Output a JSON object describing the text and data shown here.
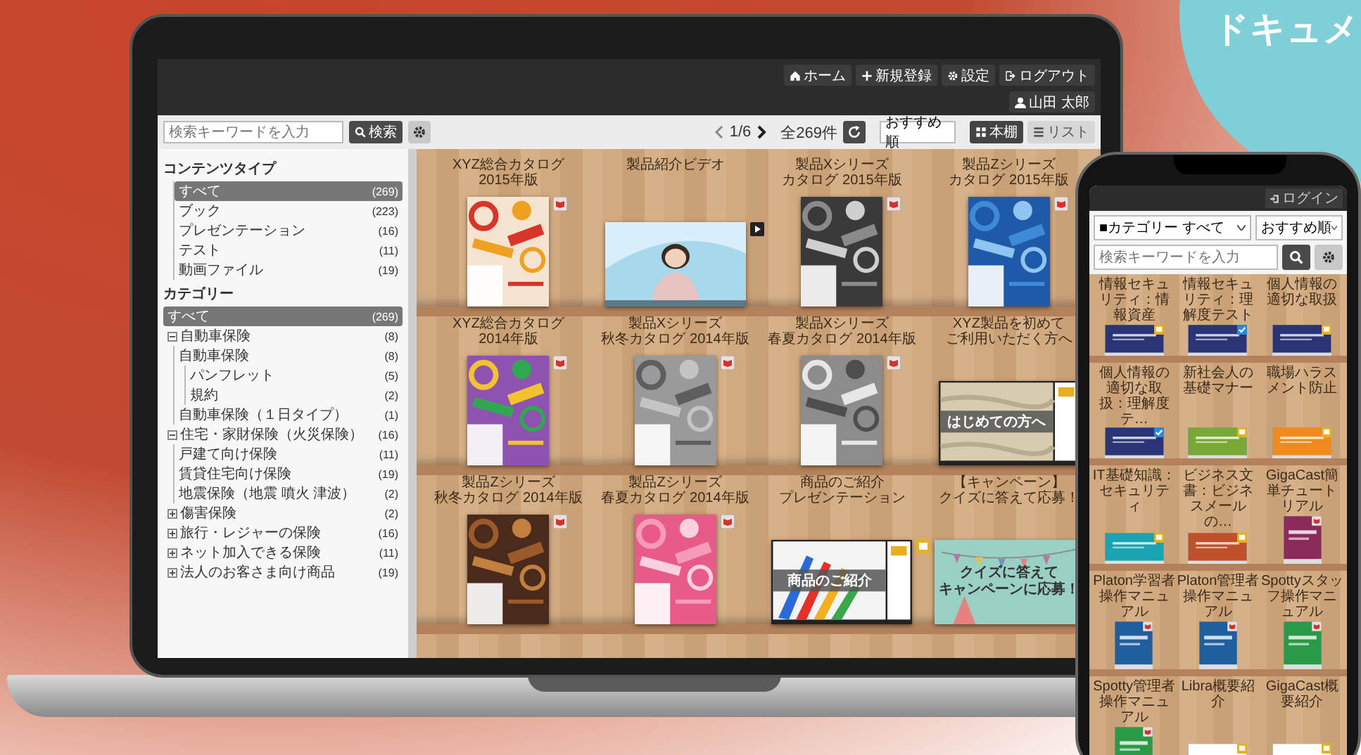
{
  "laptop": {
    "header": {
      "buttons": [
        {
          "kind": "home",
          "label": "ホーム"
        },
        {
          "kind": "add",
          "label": "新規登録"
        },
        {
          "kind": "settings",
          "label": "設定"
        },
        {
          "kind": "logout",
          "label": "ログアウト"
        }
      ],
      "user": "山田 太郎"
    },
    "toolbar": {
      "search": {
        "placeholder": "検索キーワードを入力",
        "button": "検索"
      },
      "page": "1/6",
      "total": "全269件",
      "sort": "おすすめ順",
      "views": [
        {
          "kind": "shelf",
          "label": "本棚",
          "selected": true
        },
        {
          "kind": "list",
          "label": "リスト",
          "selected": false
        }
      ]
    },
    "sidebar": {
      "sections": [
        {
          "title": "コンテンツタイプ",
          "items": [
            {
              "label": "すべて",
              "count": "(269)",
              "selected": true
            },
            {
              "label": "ブック",
              "count": "(223)",
              "selected": false
            },
            {
              "label": "プレゼンテーション",
              "count": "(16)",
              "selected": false
            },
            {
              "label": "テスト",
              "count": "(11)",
              "selected": false
            },
            {
              "label": "動画ファイル",
              "count": "(19)",
              "selected": false
            }
          ]
        },
        {
          "title": "カテゴリー",
          "items": [
            {
              "label": "すべて",
              "count": "(269)",
              "selected": true
            },
            {
              "label": "自動車保険",
              "count": "(8)",
              "selected": false,
              "expanded": true,
              "children": [
                {
                  "label": "自動車保険",
                  "count": "(8)",
                  "selected": false,
                  "children": [
                    {
                      "label": "パンフレット",
                      "count": "(5)",
                      "selected": false
                    },
                    {
                      "label": "規約",
                      "count": "(2)",
                      "selected": false
                    }
                  ]
                },
                {
                  "label": "自動車保険（１日タイプ）",
                  "count": "(1)",
                  "selected": false
                }
              ]
            },
            {
              "label": "住宅・家財保険（火災保険）",
              "count": "(16)",
              "selected": false,
              "expanded": true,
              "children": [
                {
                  "label": "戸建て向け保険",
                  "count": "(11)",
                  "selected": false
                },
                {
                  "label": "賃貸住宅向け保険",
                  "count": "(19)",
                  "selected": false
                },
                {
                  "label": "地震保険（地震 噴火 津波）",
                  "count": "(2)",
                  "selected": false
                }
              ]
            },
            {
              "label": "傷害保険",
              "count": "(2)",
              "selected": false,
              "expanded": false
            },
            {
              "label": "旅行・レジャーの保険",
              "count": "(16)",
              "selected": false,
              "expanded": false
            },
            {
              "label": "ネット加入できる保険",
              "count": "(11)",
              "selected": false,
              "expanded": false
            },
            {
              "label": "法人のお客さま向け商品",
              "count": "(19)",
              "selected": false,
              "expanded": false
            }
          ]
        }
      ]
    },
    "shelves": [
      [
        {
          "kind": "book",
          "title": [
            "XYZ総合カタログ",
            "2015年版"
          ]
        },
        {
          "kind": "video",
          "title": [
            "製品紹介ビデオ"
          ]
        },
        {
          "kind": "book",
          "title": [
            "製品Xシリーズ",
            "カタログ 2015年版"
          ]
        },
        {
          "kind": "book",
          "title": [
            "製品Zシリーズ",
            "カタログ 2015年版"
          ]
        }
      ],
      [
        {
          "kind": "book",
          "title": [
            "XYZ総合カタログ",
            "2014年版"
          ]
        },
        {
          "kind": "book",
          "title": [
            "製品Xシリーズ",
            "秋冬カタログ 2014年版"
          ]
        },
        {
          "kind": "book",
          "title": [
            "製品Xシリーズ",
            "春夏カタログ 2014年版"
          ]
        },
        {
          "kind": "presentation",
          "title": [
            "XYZ製品を初めて",
            "ご利用いただく方へ"
          ],
          "slide_text": [
            "はじめての方へ"
          ]
        }
      ],
      [
        {
          "kind": "book",
          "title": [
            "製品Zシリーズ",
            "秋冬カタログ 2014年版"
          ]
        },
        {
          "kind": "book",
          "title": [
            "製品Zシリーズ",
            "春夏カタログ 2014年版"
          ]
        },
        {
          "kind": "presentation",
          "title": [
            "商品のご紹介",
            "プレゼンテーション"
          ],
          "slide_text": [
            "商品のご紹介"
          ]
        },
        {
          "kind": "test",
          "title": [
            "【キャンペーン】",
            "クイズに答えて応募！"
          ],
          "slide_text": [
            "クイズに答えて",
            "キャンペーンに応募！"
          ]
        }
      ]
    ]
  },
  "phone": {
    "login": "ログイン",
    "category": "■カテゴリー すべて",
    "sort": "おすすめ順",
    "search": {
      "placeholder": "検索キーワードを入力"
    },
    "shelves": [
      [
        {
          "kind": "presentation",
          "title": "情報セキュリティ：情報資産"
        },
        {
          "kind": "test",
          "title": "情報セキュリティ：理解度テスト"
        },
        {
          "kind": "presentation",
          "title": "個人情報の適切な取扱"
        }
      ],
      [
        {
          "kind": "test",
          "title": "個人情報の適切な取扱：理解度テ…"
        },
        {
          "kind": "presentation",
          "title": "新社会人の基礎マナー"
        },
        {
          "kind": "presentation",
          "title": "職場ハラスメント防止"
        }
      ],
      [
        {
          "kind": "presentation",
          "title": "IT基礎知識：セキュリティ"
        },
        {
          "kind": "presentation",
          "title": "ビジネス文書：ビジネスメールの…"
        },
        {
          "kind": "book",
          "title": "GigaCast簡単チュートリアル"
        }
      ],
      [
        {
          "kind": "book",
          "title": "Platon学習者操作マニュアル"
        },
        {
          "kind": "book",
          "title": "Platon管理者操作マニュアル"
        },
        {
          "kind": "book",
          "title": "Spottyスタッフ操作マニュアル"
        }
      ],
      [
        {
          "kind": "book",
          "title": "Spotty管理者操作マニュアル"
        },
        {
          "kind": "presentation",
          "title": "Libra概要紹介"
        },
        {
          "kind": "presentation",
          "title": "GigaCast概要紹介"
        }
      ]
    ]
  },
  "banner": {
    "text": "ドキュメ"
  }
}
